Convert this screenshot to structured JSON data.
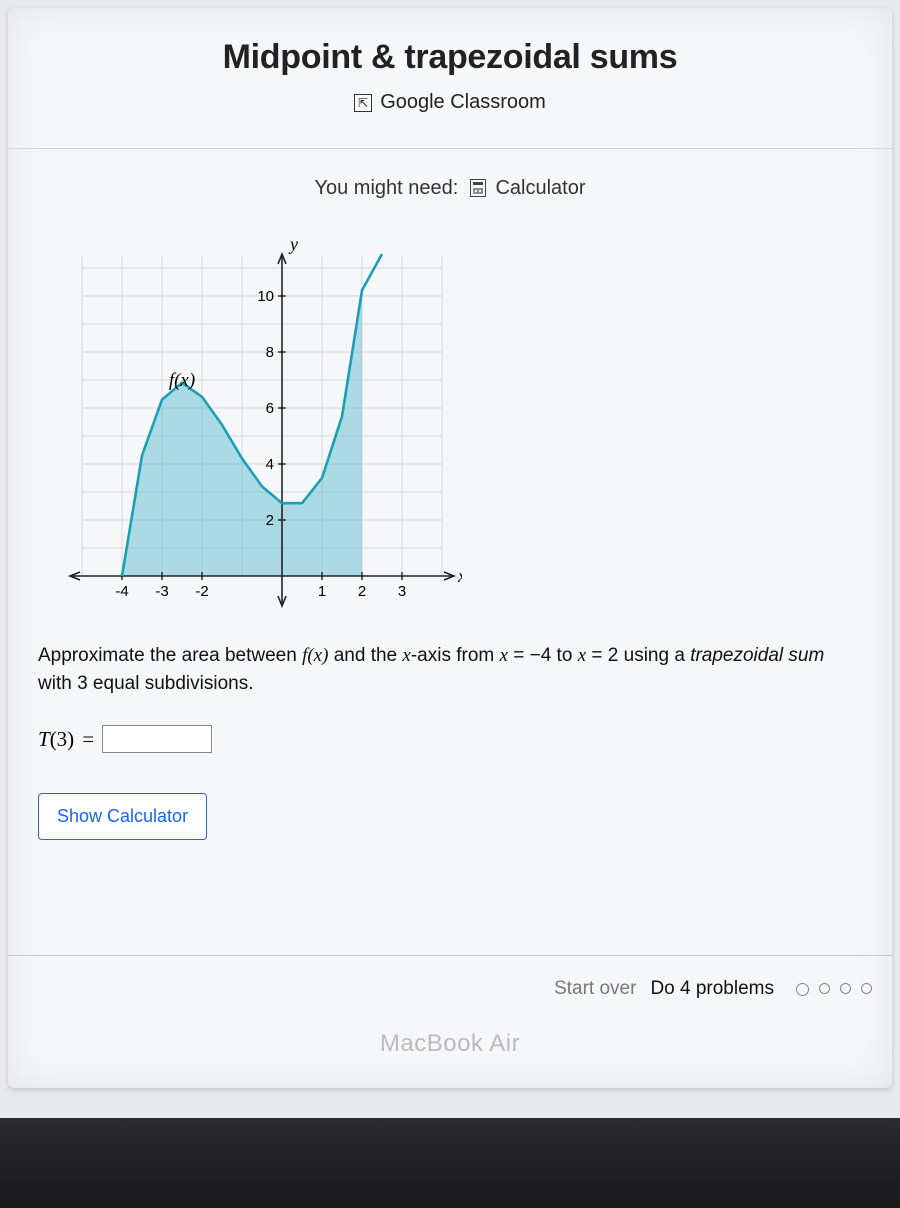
{
  "header": {
    "title": "Midpoint & trapezoidal sums",
    "classroom_label": "Google Classroom"
  },
  "need": {
    "prefix": "You might need:",
    "tool": "Calculator"
  },
  "chart_data": {
    "type": "line",
    "title": "",
    "xlabel": "x",
    "ylabel": "y",
    "function_label": "f(x)",
    "xlim": [
      -5,
      4
    ],
    "ylim": [
      -1,
      11
    ],
    "xticks": [
      -4,
      -3,
      -2,
      1,
      2,
      3
    ],
    "yticks": [
      2,
      4,
      6,
      8,
      10
    ],
    "shaded_region_x": [
      -4,
      2
    ],
    "series": [
      {
        "name": "f(x)",
        "x": [
          -4,
          -3.5,
          -3,
          -2.5,
          -2,
          -1.5,
          -1,
          -0.5,
          0,
          0.5,
          1,
          1.5,
          2,
          2.5
        ],
        "y": [
          0,
          4.3,
          6.3,
          6.9,
          6.4,
          5.4,
          4.2,
          3.2,
          2.6,
          2.6,
          3.5,
          5.7,
          10.2,
          11.5
        ]
      }
    ]
  },
  "question": {
    "pre": "Approximate the area between ",
    "fx": "f(x)",
    "mid1": " and the ",
    "xvar": "x",
    "mid2": "-axis from ",
    "eq1_lhs": "x",
    "eq1_rhs": "−4",
    "to": " to ",
    "eq2_lhs": "x",
    "eq2_rhs": "2",
    "using": " using a ",
    "method": "trapezoidal sum",
    "with": " with ",
    "subdiv": "3",
    "tail": " equal subdivisions."
  },
  "answer": {
    "label_T": "T",
    "label_n": "(3)",
    "equals": "=",
    "value": ""
  },
  "buttons": {
    "show_calculator": "Show Calculator"
  },
  "footer": {
    "start_over": "Start over",
    "do_problems": "Do 4 problems",
    "progress_total": 4,
    "progress_done": 0
  },
  "device": {
    "label": "MacBook Air"
  }
}
